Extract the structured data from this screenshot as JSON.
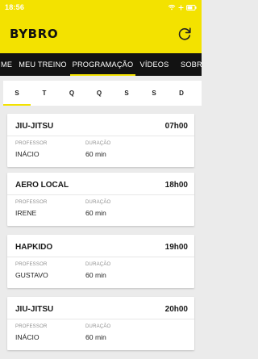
{
  "status_bar": {
    "time": "18:56",
    "icons": [
      "wifi-icon",
      "battery-icon",
      "plus-icon"
    ]
  },
  "app_bar": {
    "brand": "BYBRO",
    "refresh_icon": "refresh-icon"
  },
  "nav_tabs": [
    {
      "label": "ME"
    },
    {
      "label": "MEU TREINO"
    },
    {
      "label": "PROGRAMAÇÃO",
      "active": true
    },
    {
      "label": "VÍDEOS"
    },
    {
      "label": "SOBRE"
    }
  ],
  "days": [
    {
      "label": "S",
      "active": true
    },
    {
      "label": "T"
    },
    {
      "label": "Q"
    },
    {
      "label": "Q"
    },
    {
      "label": "S"
    },
    {
      "label": "S"
    },
    {
      "label": "D"
    }
  ],
  "classes": [
    {
      "name": "JIU-JITSU",
      "time": "07h00",
      "teacher_label": "PROFESSOR",
      "teacher": "INÁCIO",
      "duration_label": "DURAÇÃO",
      "duration": "60 min"
    },
    {
      "name": "AERO LOCAL",
      "time": "18h00",
      "teacher_label": "PROFESSOR",
      "teacher": "IRENE",
      "duration_label": "DURAÇÃO",
      "duration": "60 min"
    },
    {
      "name": "HAPKIDO",
      "time": "19h00",
      "teacher_label": "PROFESSOR",
      "teacher": "GUSTAVO",
      "duration_label": "DURAÇÃO",
      "duration": "60 min"
    },
    {
      "name": "JIU-JITSU",
      "time": "20h00",
      "teacher_label": "PROFESSOR",
      "teacher": "INÁCIO",
      "duration_label": "DURAÇÃO",
      "duration": "60 min"
    }
  ],
  "colors": {
    "brand_yellow": "#f3e200",
    "nav_black": "#121212",
    "page_bg": "#ebebeb",
    "card_bg": "#ffffff",
    "muted_text": "#8f8f8f"
  }
}
